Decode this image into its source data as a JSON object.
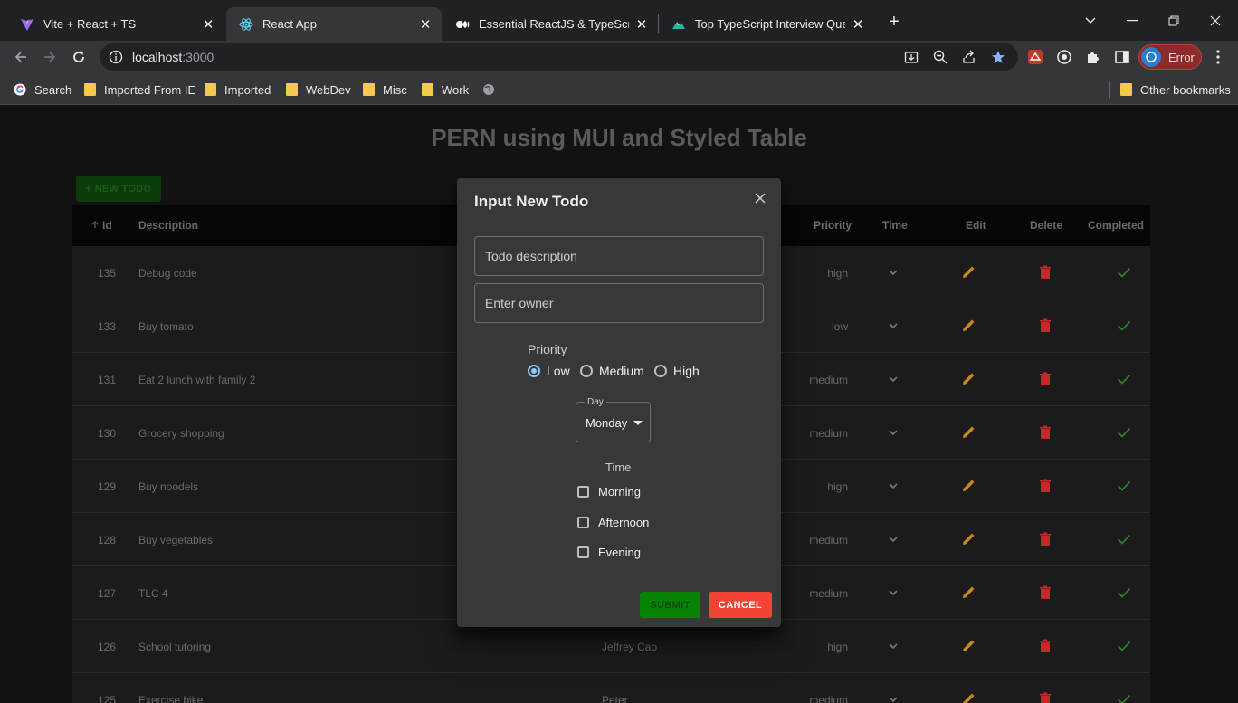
{
  "browser": {
    "tabs": [
      {
        "title": "Vite + React + TS",
        "icon": "vite-icon",
        "active": false
      },
      {
        "title": "React App",
        "icon": "react-icon",
        "active": true
      },
      {
        "title": "Essential ReactJS & TypeScript Int",
        "icon": "medium-icon",
        "active": false
      },
      {
        "title": "Top TypeScript Interview Questio",
        "icon": "site-icon",
        "active": false
      }
    ],
    "url_host": "localhost",
    "url_port": ":3000",
    "profile_label": "Error",
    "bookmarks": [
      "Search",
      "Imported From IE",
      "Imported",
      "WebDev",
      "Misc",
      "Work"
    ],
    "other_bookmarks": "Other bookmarks"
  },
  "page": {
    "title": "PERN using MUI and Styled Table",
    "new_todo_label": "+ NEW TODO"
  },
  "table": {
    "headers": {
      "id": "Id",
      "description": "Description",
      "priority": "Priority",
      "time": "Time",
      "edit": "Edit",
      "delete": "Delete",
      "completed": "Completed"
    },
    "rows": [
      {
        "id": "135",
        "description": "Debug code",
        "owner": "",
        "priority": "high"
      },
      {
        "id": "133",
        "description": "Buy tomato",
        "owner": "",
        "priority": "low"
      },
      {
        "id": "131",
        "description": "Eat 2 lunch with family 2",
        "owner": "",
        "priority": "medium"
      },
      {
        "id": "130",
        "description": "Grocery shopping",
        "owner": "",
        "priority": "medium"
      },
      {
        "id": "129",
        "description": "Buy noodels",
        "owner": "",
        "priority": "high"
      },
      {
        "id": "128",
        "description": "Buy vegetables",
        "owner": "",
        "priority": "medium"
      },
      {
        "id": "127",
        "description": "TLC 4",
        "owner": "",
        "priority": "medium"
      },
      {
        "id": "126",
        "description": "School tutoring",
        "owner": "Jeffrey Cao",
        "priority": "high"
      },
      {
        "id": "125",
        "description": "Exercise bike",
        "owner": "Peter",
        "priority": "medium"
      }
    ]
  },
  "dialog": {
    "title": "Input New Todo",
    "description_placeholder": "Todo description",
    "owner_placeholder": "Enter owner",
    "priority_label": "Priority",
    "priority_options": [
      "Low",
      "Medium",
      "High"
    ],
    "priority_selected": "Low",
    "day_label": "Day",
    "day_value": "Monday",
    "time_label": "Time",
    "time_options": [
      "Morning",
      "Afternoon",
      "Evening"
    ],
    "submit_label": "SUBMIT",
    "cancel_label": "CANCEL"
  },
  "colors": {
    "edit_icon": "#c88a1e",
    "delete_icon": "#c62828",
    "completed_icon": "#2e7d32",
    "accent_radio": "#90caf9",
    "submit_button": "#078407",
    "cancel_button": "#f44336"
  }
}
